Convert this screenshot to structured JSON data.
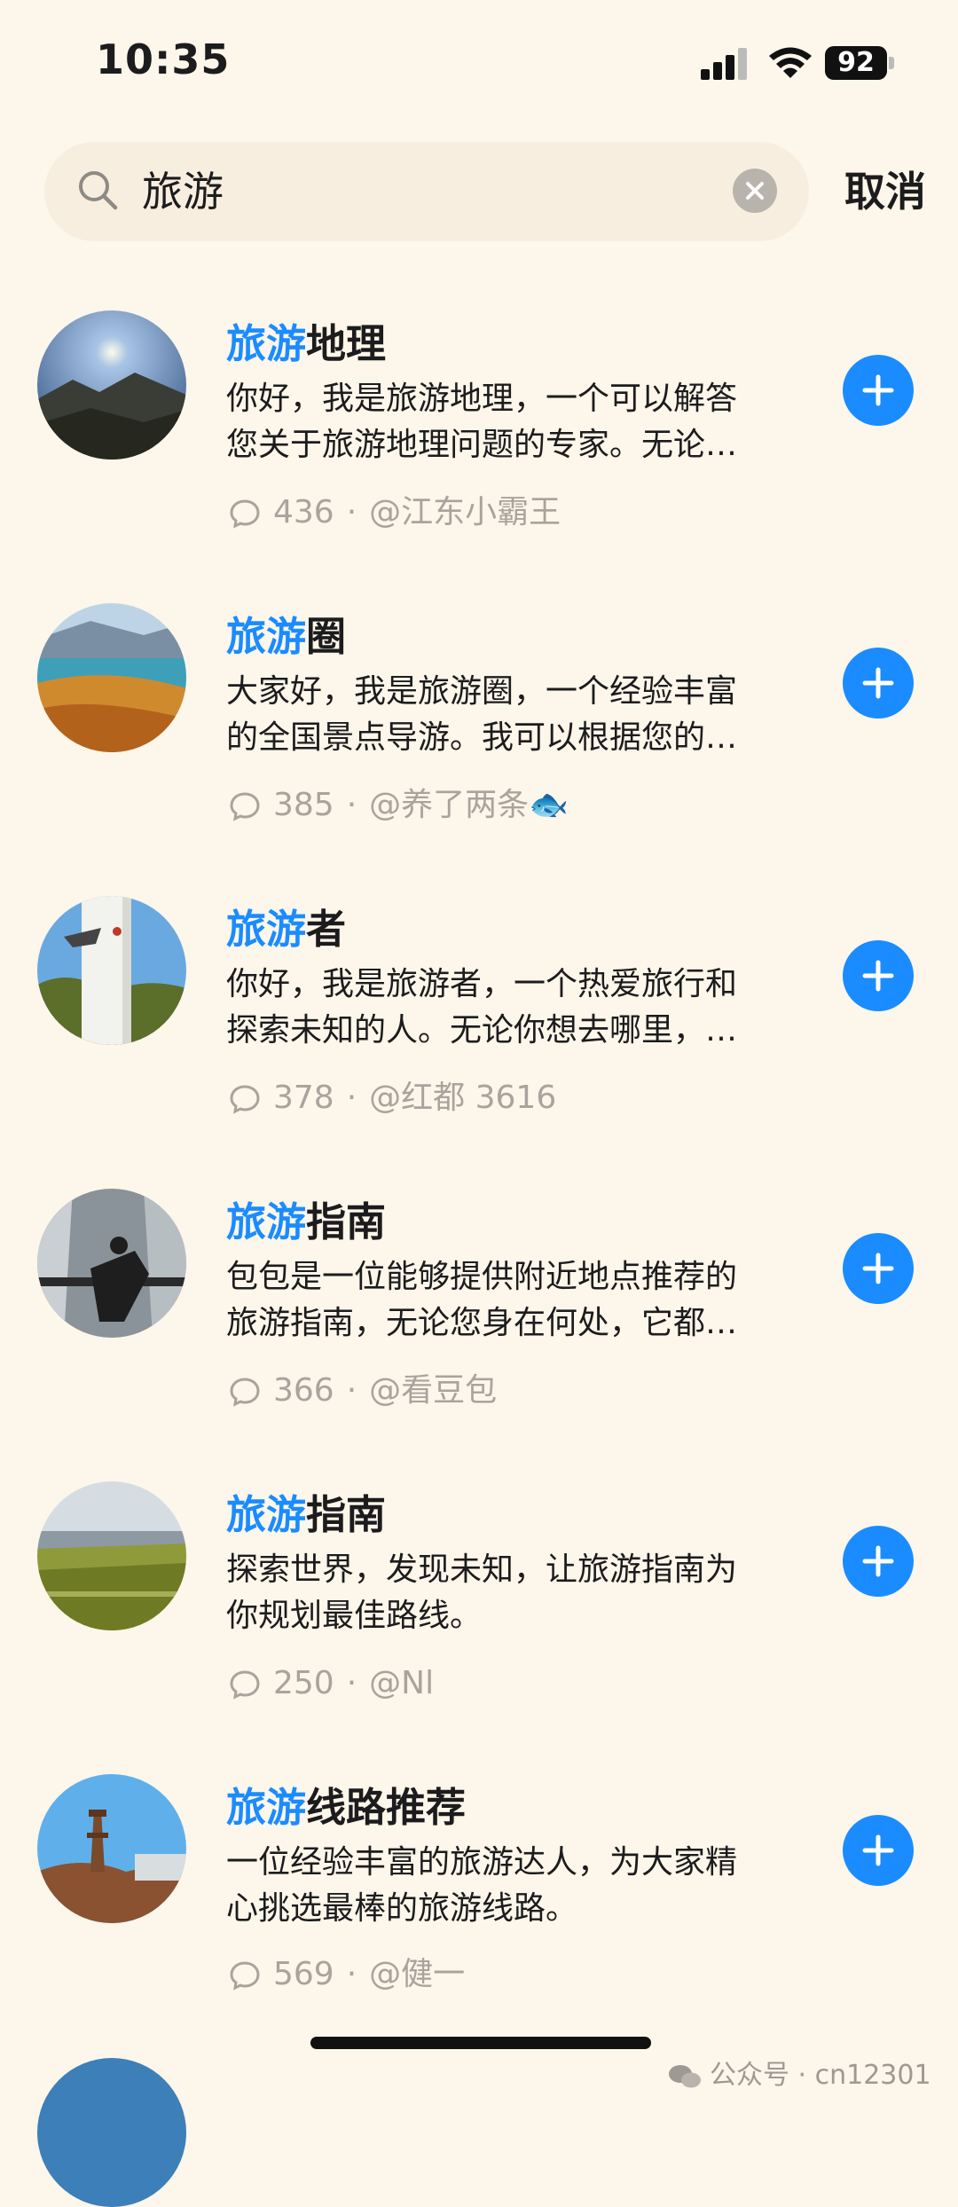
{
  "status_bar": {
    "time": "10:35",
    "battery": "92"
  },
  "search": {
    "query": "旅游",
    "cancel_label": "取消"
  },
  "results": [
    {
      "title_highlight": "旅游",
      "title_rest": "地理",
      "desc_line1": "你好，我是旅游地理，一个可以解答",
      "desc_line2": "您关于旅游地理问题的专家。无论…",
      "count": "436",
      "author": "@江东小霸王"
    },
    {
      "title_highlight": "旅游",
      "title_rest": "圈",
      "desc_line1": "大家好，我是旅游圈，一个经验丰富",
      "desc_line2": "的全国景点导游。我可以根据您的…",
      "count": "385",
      "author": "@养了两条🐟"
    },
    {
      "title_highlight": "旅游",
      "title_rest": "者",
      "desc_line1": "你好，我是旅游者，一个热爱旅行和",
      "desc_line2": "探索未知的人。无论你想去哪里，…",
      "count": "378",
      "author": "@红都 3616"
    },
    {
      "title_highlight": "旅游",
      "title_rest": "指南",
      "desc_line1": "包包是一位能够提供附近地点推荐的",
      "desc_line2": "旅游指南，无论您身在何处，它都…",
      "count": "366",
      "author": "@看豆包"
    },
    {
      "title_highlight": "旅游",
      "title_rest": "指南",
      "desc_line1": "探索世界，发现未知，让旅游指南为",
      "desc_line2": "你规划最佳路线。",
      "count": "250",
      "author": "@Nl"
    },
    {
      "title_highlight": "旅游",
      "title_rest": "线路推荐",
      "desc_line1": "一位经验丰富的旅游达人，为大家精",
      "desc_line2": "心挑选最棒的旅游线路。",
      "count": "569",
      "author": "@健一"
    }
  ],
  "meta_separator": "·",
  "watermark": "公众号 · cn12301",
  "colors": {
    "accent": "#1a8cff",
    "background": "#fdf6ea",
    "muted": "#a8a49d"
  },
  "icons": [
    "search-icon",
    "clear-icon",
    "comment-icon",
    "plus-icon",
    "wechat-icon"
  ]
}
